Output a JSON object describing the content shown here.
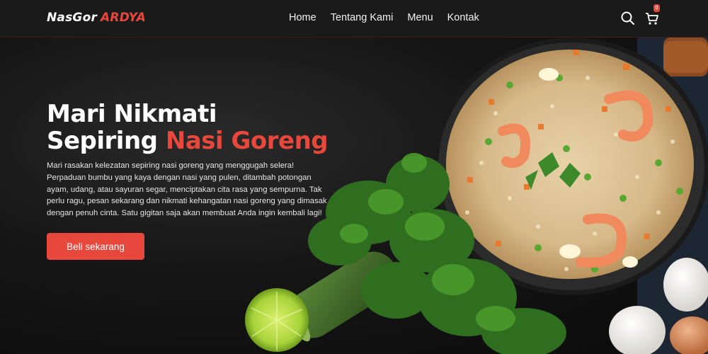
{
  "navbar": {
    "logo_part1": "NasGor",
    "logo_part2": "ARDYA",
    "links": [
      "Home",
      "Tentang Kami",
      "Menu",
      "Kontak"
    ],
    "cart_count": "0",
    "icons": [
      "search-icon",
      "cart-icon"
    ]
  },
  "hero": {
    "title_line1": "Mari Nikmati",
    "title_line2_plain": "Sepiring",
    "title_line2_accent": "Nasi Goreng",
    "description": "Mari rasakan kelezatan sepiring nasi goreng yang menggugah selera! Perpaduan bumbu yang kaya dengan nasi yang pulen, ditambah potongan ayam, udang, atau sayuran segar, menciptakan cita rasa yang sempurna. Tak perlu ragu, pesan sekarang dan nikmati kehangatan nasi goreng yang dimasak dengan penuh cinta. Satu gigitan saja akan membuat Anda ingin kembali lagi!",
    "button_label": "Beli sekarang"
  },
  "colors": {
    "accent": "#e8473b",
    "navbar_bg": "#1a1a1a",
    "page_bg": "#111111"
  }
}
